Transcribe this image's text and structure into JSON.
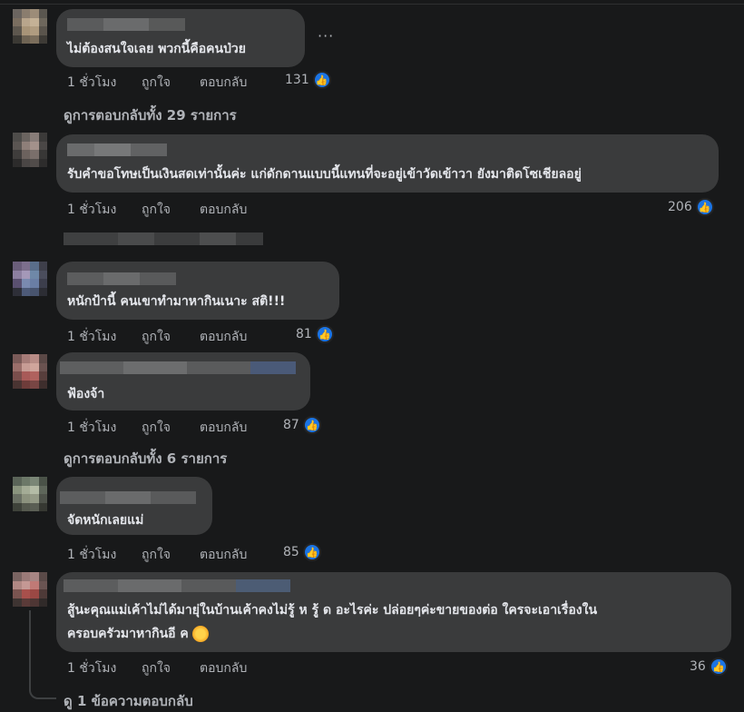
{
  "comments": [
    {
      "text": "ไม่ต้องสนใจเลย พวกนี้คือคนป่วย",
      "time": "1 ชั่วโมง",
      "like": "ถูกใจ",
      "reply": "ตอบกลับ",
      "count": "131",
      "more": "···",
      "view_replies": "ดูการตอบกลับทั้ง 29 รายการ"
    },
    {
      "text": "รับคำขอโทษเป็นเงินสดเท่านั้นค่ะ แก่ดักดานแบบนี้แทนที่จะอยู่เข้าวัดเข้าวา ยังมาติดโซเชียลอยู่",
      "time": "1 ชั่วโมง",
      "like": "ถูกใจ",
      "reply": "ตอบกลับ",
      "count": "206"
    },
    {
      "text": "หนักป้านี้ คนเขาทำมาหากินเนาะ สติ!!!",
      "time": "1 ชั่วโมง",
      "like": "ถูกใจ",
      "reply": "ตอบกลับ",
      "count": "81"
    },
    {
      "text": "ฟ้องจ้า",
      "time": "1 ชั่วโมง",
      "like": "ถูกใจ",
      "reply": "ตอบกลับ",
      "count": "87",
      "view_replies": "ดูการตอบกลับทั้ง 6 รายการ"
    },
    {
      "text": "จัดหนักเลยแม่",
      "time": "1 ชั่วโมง",
      "like": "ถูกใจ",
      "reply": "ตอบกลับ",
      "count": "85"
    },
    {
      "text_line1": "สู้นะคุณแม่เค้าไม่ได้มายุ่ในบ้านเค้าคงไม่รู้ ห รู้ ด อะไรค่ะ ปล่อยๆค่ะขายของต่อ ใครจะเอาเรื่องใน",
      "text_line2": "ครอบครัวมาหากินอี ค",
      "time": "1 ชั่วโมง",
      "like": "ถูกใจ",
      "reply": "ตอบกลับ",
      "count": "36",
      "view_replies": "ดู 1 ข้อความตอบกลับ"
    }
  ],
  "colors": {
    "background": "#18191a",
    "bubble": "#3a3b3c",
    "like": "#1b74e4",
    "muted": "#b0b3b8"
  },
  "icons": {
    "like": "thumbs-up-icon",
    "emoji": "sun-emoji-icon"
  }
}
